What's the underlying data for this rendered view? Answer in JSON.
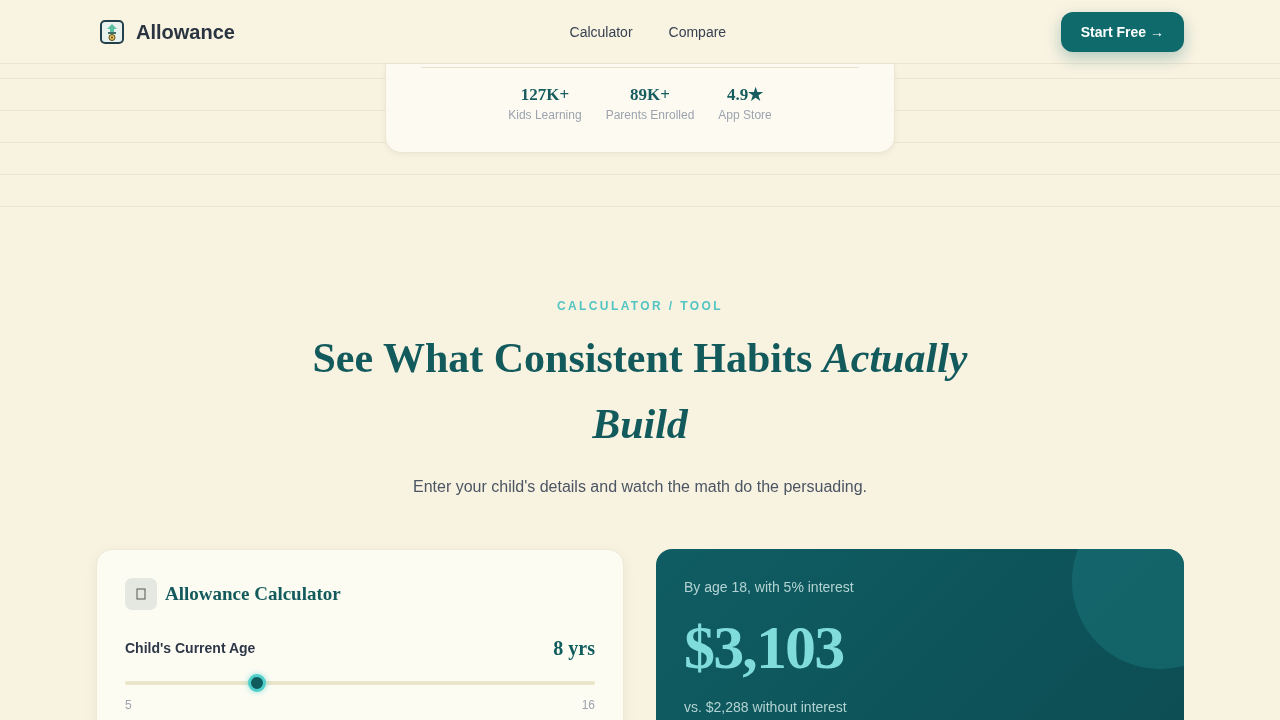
{
  "header": {
    "brand": "Allowance",
    "nav": [
      "Calculator",
      "Compare"
    ],
    "cta": "Start Free →"
  },
  "stats": [
    {
      "value": "127K+",
      "label": "Kids Learning"
    },
    {
      "value": "89K+",
      "label": "Parents Enrolled"
    },
    {
      "value": "4.9★",
      "label": "App Store"
    }
  ],
  "calculator_section": {
    "eyebrow": "CALCULATOR / TOOL",
    "heading": "See What Consistent Habits *Actually Build*",
    "subtitle": "Enter your child's details and watch the math do the persuading."
  },
  "calculator": {
    "title": "Allowance Calculator",
    "sliders": [
      {
        "label": "Child's Current Age",
        "reading": "8 yrs",
        "level": 0.28,
        "min": "5",
        "max": "16"
      }
    ]
  },
  "result": {
    "caption": "By age 18, with 5% interest",
    "amount": "$3,103",
    "comparison": "vs. $2,288 without interest"
  }
}
